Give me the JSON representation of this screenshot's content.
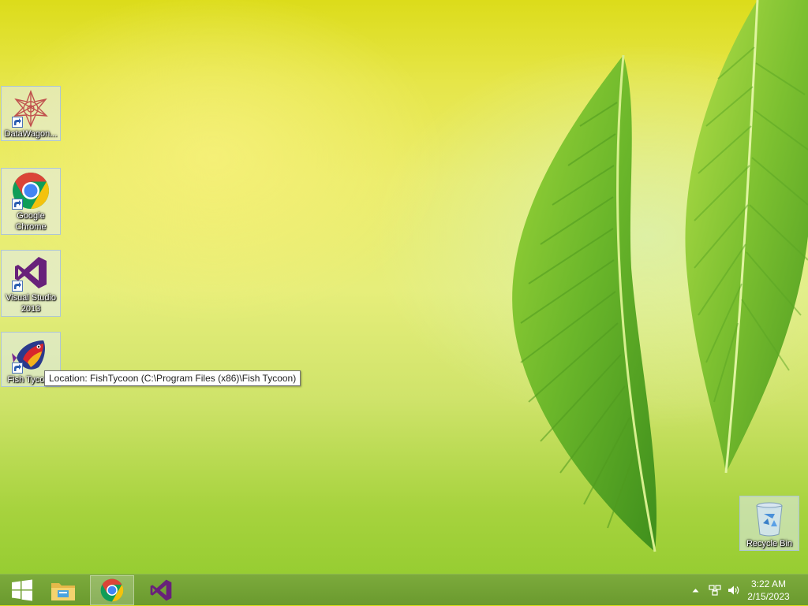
{
  "desktop": {
    "icons": [
      {
        "label": "DataWagon..."
      },
      {
        "label": "Google Chrome"
      },
      {
        "label": "Visual Studio 2013"
      },
      {
        "label": "Fish Tycoon"
      },
      {
        "label": "Recycle Bin"
      }
    ],
    "tooltip": "Location: FishTycoon (C:\\Program Files (x86)\\Fish Tycoon)"
  },
  "taskbar": {
    "buttons": [
      {
        "icon": "windows-logo-icon"
      },
      {
        "icon": "file-explorer-icon"
      },
      {
        "icon": "chrome-icon",
        "active": true
      },
      {
        "icon": "visual-studio-icon"
      }
    ],
    "tray": {
      "icons": [
        "show-hidden-icons-chevron",
        "network-icon",
        "volume-icon"
      ],
      "time": "3:22 AM",
      "date": "2/15/2023"
    }
  },
  "colors": {
    "taskbar": "#6f9f33",
    "chrome_red": "#db4437",
    "chrome_yellow": "#f4c20d",
    "chrome_green": "#0f9d58",
    "chrome_blue": "#4285f4",
    "visual_studio": "#68217a"
  }
}
